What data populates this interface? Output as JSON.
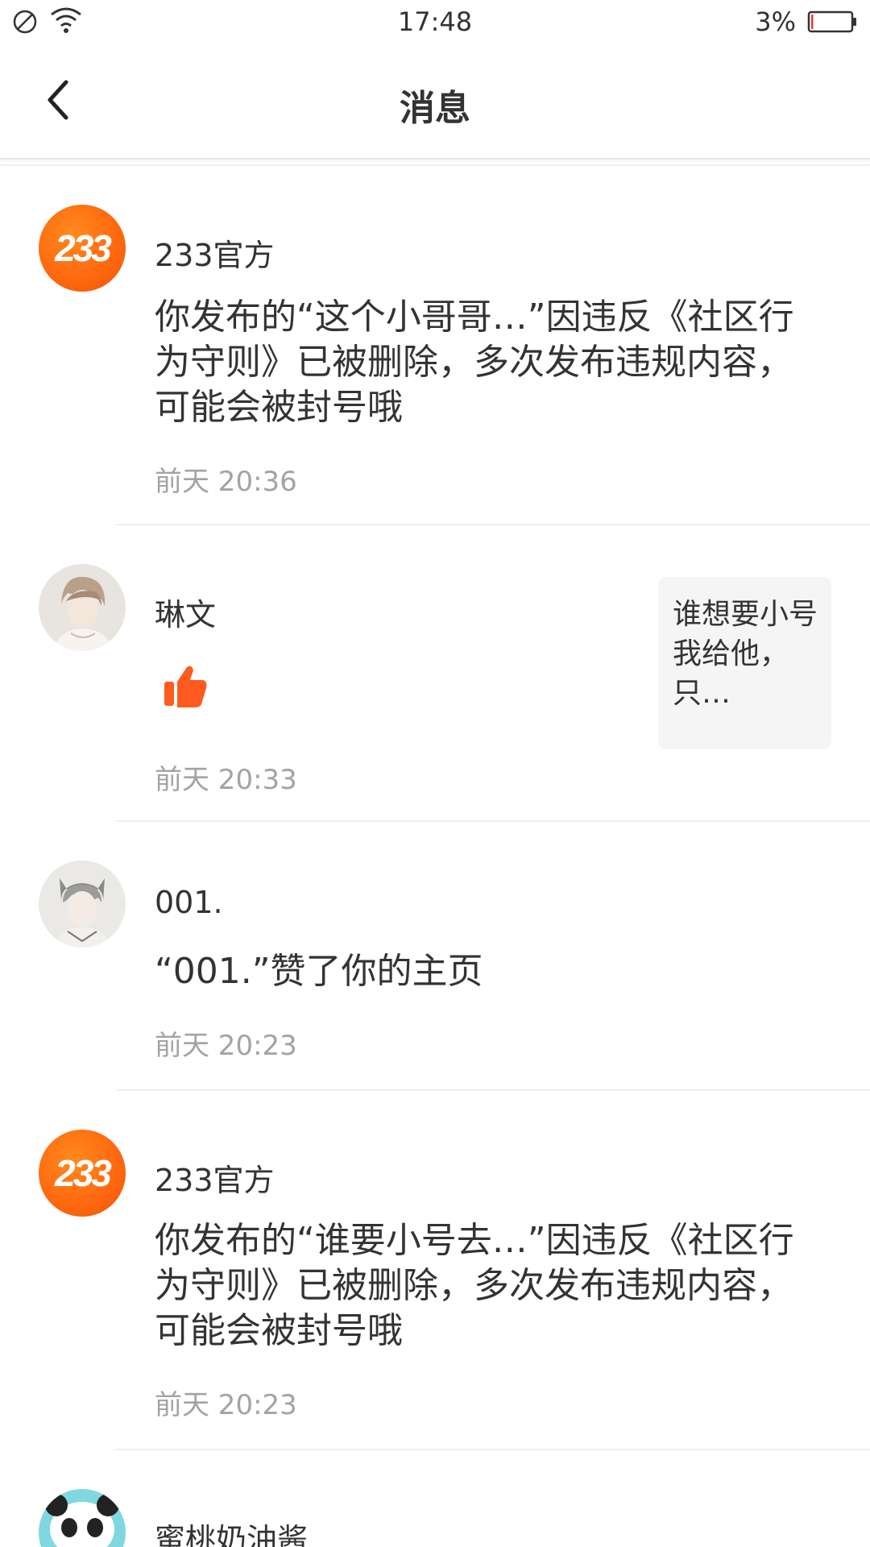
{
  "status_bar": {
    "time": "17:48",
    "battery_percent": "3%",
    "battery_level": 0.03,
    "battery_color": "#e53935",
    "icons": [
      "do-not-disturb-icon",
      "wifi-icon",
      "battery-icon"
    ]
  },
  "header": {
    "title": "消息",
    "back_icon": "chevron-left-icon"
  },
  "colors": {
    "accent": "#ff6a10",
    "text_primary": "#333333",
    "text_secondary": "#a3a3a3",
    "divider": "#eeeeee",
    "card_bg": "#f5f5f5"
  },
  "messages": [
    {
      "avatar_text": "233",
      "sender": "233官方",
      "body": "你发布的“这个小哥哥…”因违反《社区行为守则》已被删除，多次发布违规内容，可能会被封号哦",
      "time": "前天 20:36"
    },
    {
      "avatar": "user-avatar-linwen",
      "sender": "琳文",
      "reaction_icon": "thumb-like-icon",
      "preview": "谁想要小号我给他，只…",
      "time": "前天 20:33"
    },
    {
      "avatar": "user-avatar-001",
      "sender": "001.",
      "body": "“001.”赞了你的主页",
      "time": "前天 20:23"
    },
    {
      "avatar_text": "233",
      "sender": "233官方",
      "body": "你发布的“谁要小号去…”因违反《社区行为守则》已被删除，多次发布违规内容，可能会被封号哦",
      "time": "前天 20:23"
    },
    {
      "avatar": "user-avatar-peach",
      "sender": "蜜桃奶油酱"
    }
  ]
}
